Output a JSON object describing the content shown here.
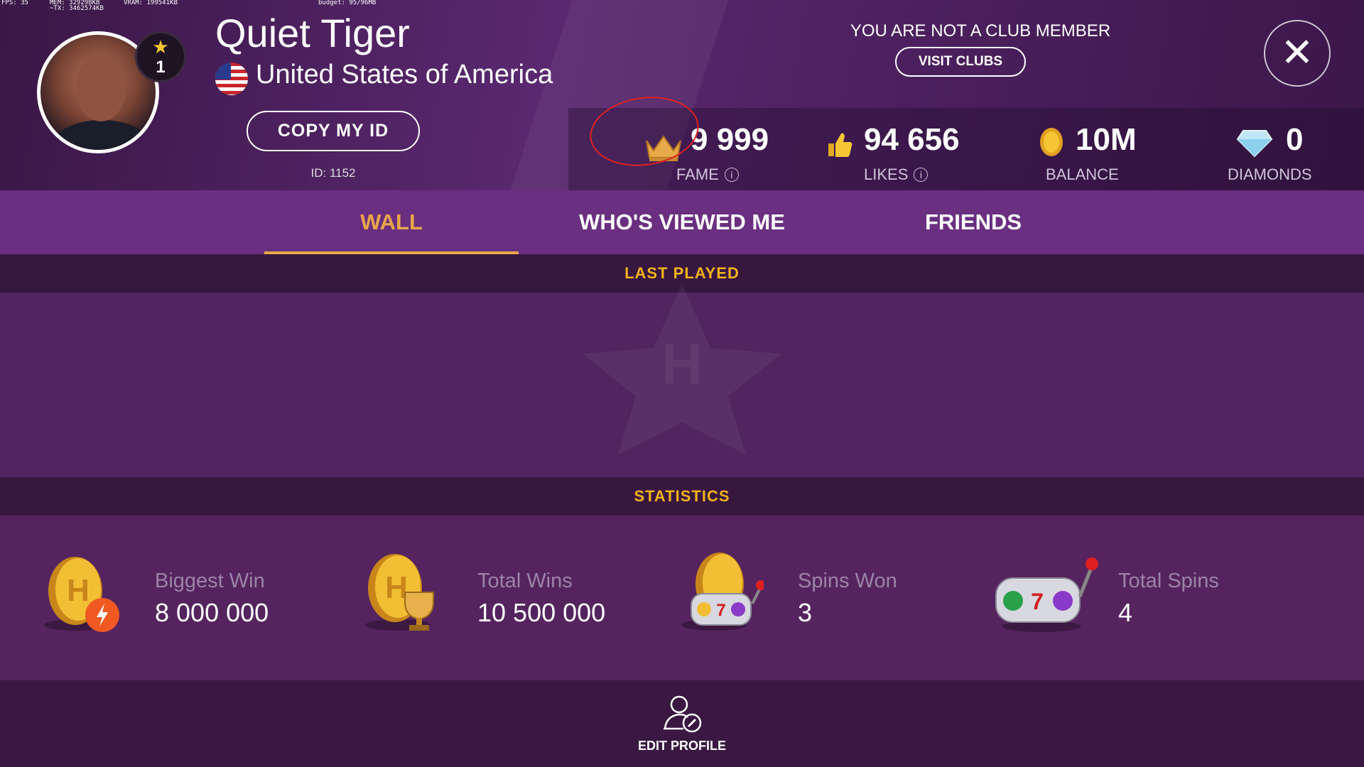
{
  "debug": {
    "fps": "FPS: 35",
    "mem": "MEM: 329298KB",
    "tx": "~TX: 3462574KB",
    "vram": "VRAM: 199541KB",
    "budget": "budget: 95/96MB"
  },
  "profile": {
    "name": "Quiet Tiger",
    "country": "United States of America",
    "level": "1",
    "copy_id_label": "COPY MY ID",
    "id_text": "ID: 1152"
  },
  "club": {
    "status_text": "YOU ARE NOT A CLUB MEMBER",
    "visit_label": "VISIT CLUBS"
  },
  "close_label": "✕",
  "stats_bar": {
    "fame": {
      "value": "9 999",
      "label": "FAME"
    },
    "likes": {
      "value": "94 656",
      "label": "LIKES"
    },
    "balance": {
      "value": "10M",
      "label": "BALANCE"
    },
    "diamonds": {
      "value": "0",
      "label": "DIAMONDS"
    }
  },
  "tabs": [
    {
      "label": "WALL",
      "active": true
    },
    {
      "label": "WHO'S VIEWED ME",
      "active": false
    },
    {
      "label": "FRIENDS",
      "active": false
    }
  ],
  "sections": {
    "last_played": "LAST PLAYED",
    "statistics": "STATISTICS"
  },
  "statistics": [
    {
      "title": "Biggest Win",
      "value": "8 000 000",
      "icon": "coin-lightning-icon"
    },
    {
      "title": "Total Wins",
      "value": "10 500 000",
      "icon": "coin-trophy-icon"
    },
    {
      "title": "Spins Won",
      "value": "3",
      "icon": "coin-slot-machine-icon"
    },
    {
      "title": "Total Spins",
      "value": "4",
      "icon": "slot-machine-icon"
    }
  ],
  "footer": {
    "edit_profile_label": "EDIT PROFILE"
  },
  "colors": {
    "accent": "#e8a64a",
    "section_header": "#f3b21a",
    "annotation": "#e02020"
  }
}
